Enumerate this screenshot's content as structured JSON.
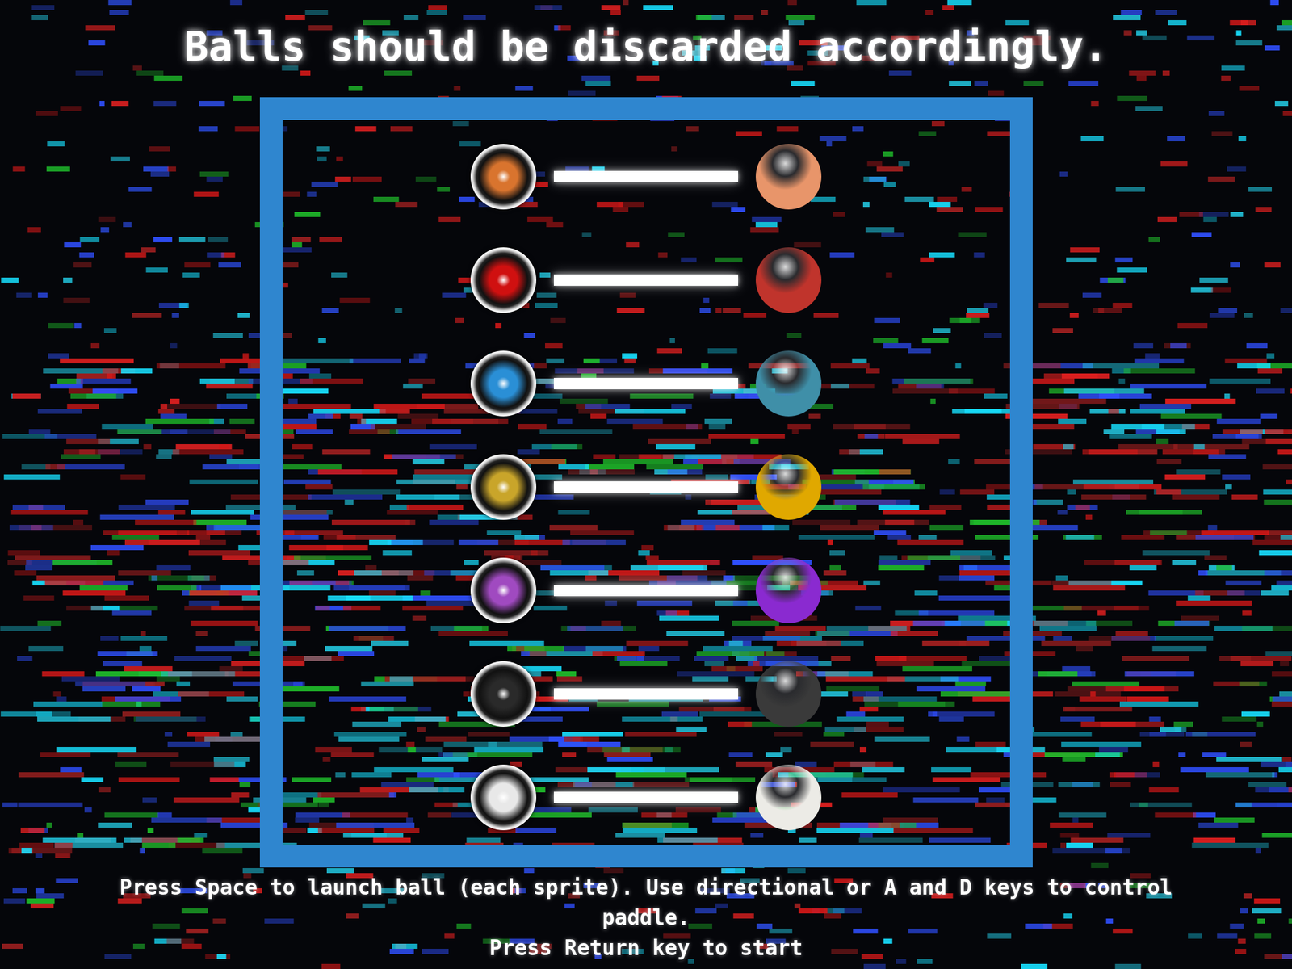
{
  "title": "Balls should be discarded accordingly.",
  "rows": [
    {
      "color": "#d9742e",
      "ball_color": "#e8956a"
    },
    {
      "color": "#d01010",
      "ball_color": "#c0342c"
    },
    {
      "color": "#2a8fd6",
      "ball_color": "#3f8fa8"
    },
    {
      "color": "#c9a52a",
      "ball_color": "#e0a800"
    },
    {
      "color": "#a04ac0",
      "ball_color": "#8a2ad0"
    },
    {
      "color": "#2a2a2a",
      "ball_color": "#3a3a3a"
    },
    {
      "color": "#e8e8e8",
      "ball_color": "#ecebe6"
    }
  ],
  "instructions": [
    "Press Space to launch ball (each sprite). Use directional or A and D keys to control paddle.",
    "Press Return key to start"
  ]
}
